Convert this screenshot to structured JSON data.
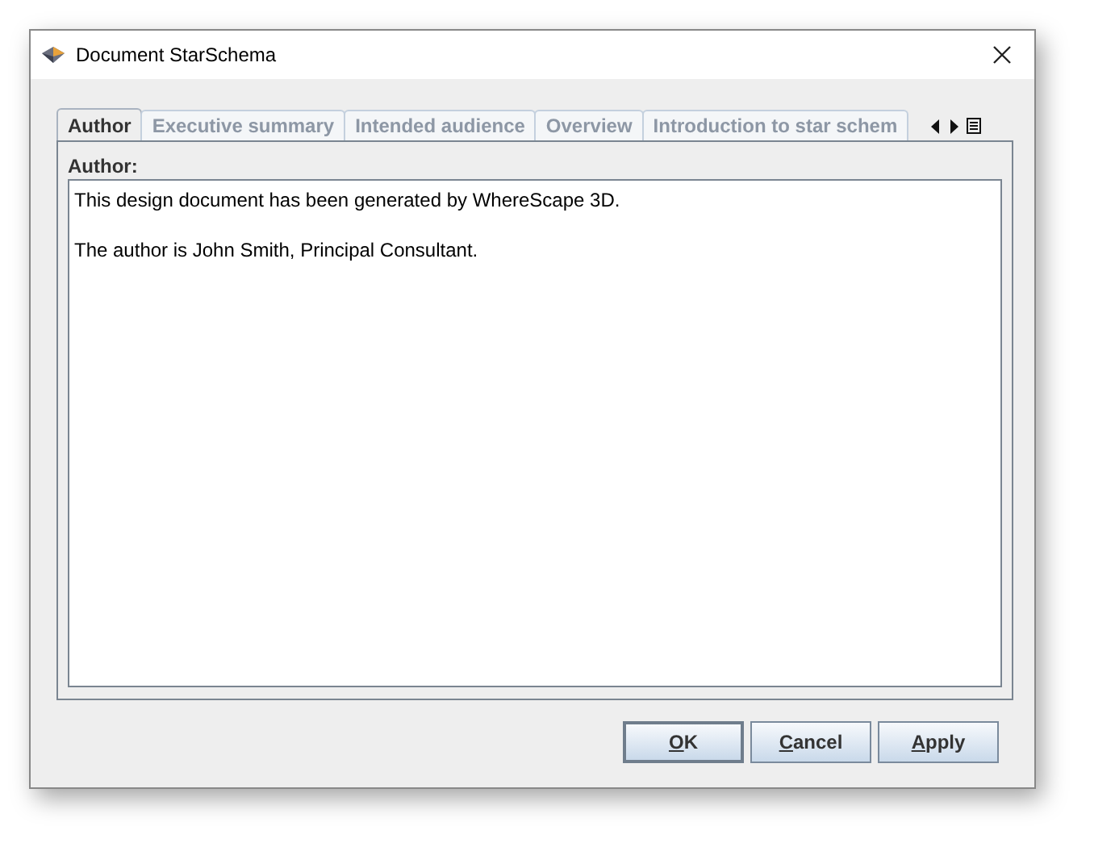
{
  "window": {
    "title": "Document StarSchema"
  },
  "tabs": [
    {
      "label": "Author",
      "selected": true
    },
    {
      "label": "Executive summary",
      "selected": false
    },
    {
      "label": "Intended audience",
      "selected": false
    },
    {
      "label": "Overview",
      "selected": false
    },
    {
      "label": "Introduction to star schem",
      "selected": false
    }
  ],
  "panel": {
    "label": "Author:",
    "paragraphs": [
      "This design document has been generated by WhereScape 3D.",
      "The author is John Smith, Principal Consultant."
    ]
  },
  "buttons": [
    {
      "label": "OK",
      "default": true
    },
    {
      "label": "Cancel",
      "default": false
    },
    {
      "label": "Apply",
      "default": false
    }
  ]
}
